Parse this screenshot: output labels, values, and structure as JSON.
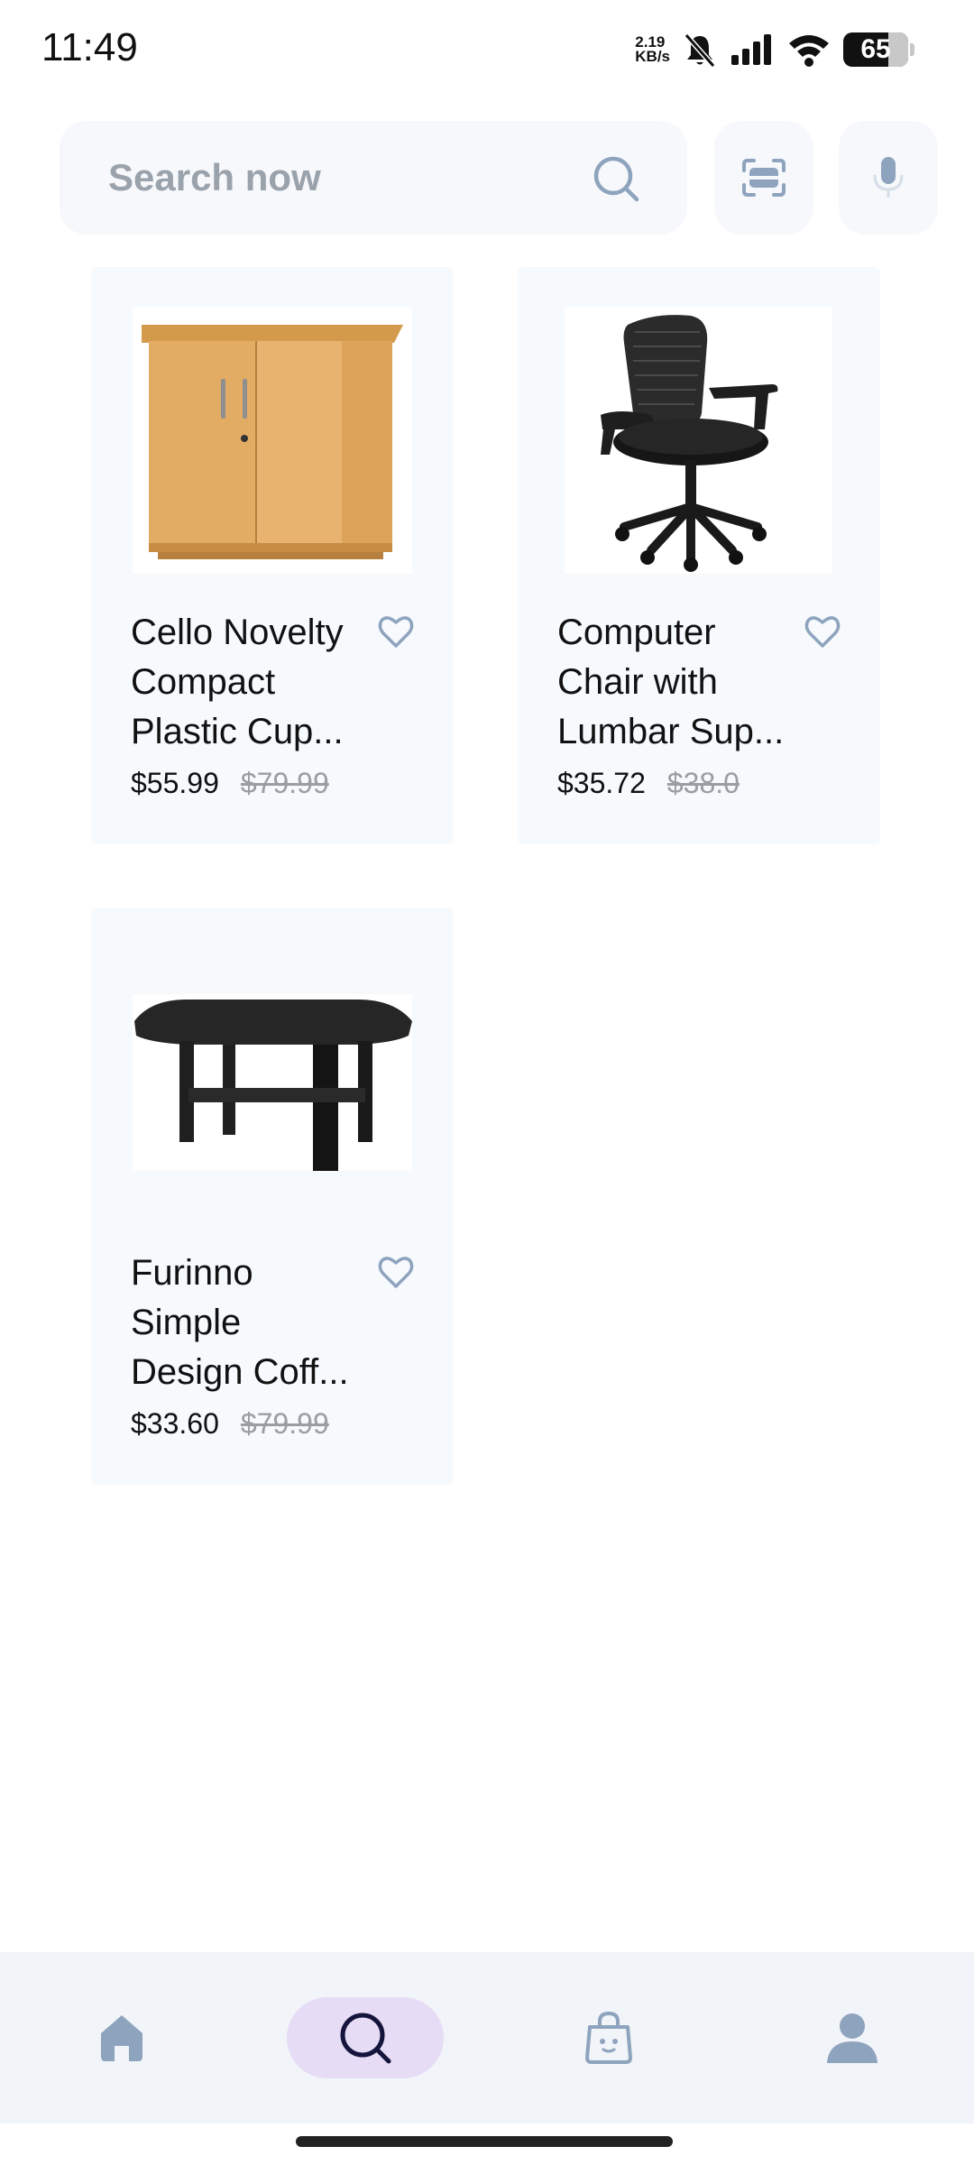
{
  "status_bar": {
    "time": "11:49",
    "net_speed_value": "2.19",
    "net_speed_unit": "KB/s",
    "battery": "65"
  },
  "search": {
    "placeholder": "Search now"
  },
  "products": [
    {
      "title_lines": [
        "Cello Novelty",
        "Compact",
        "Plastic Cup..."
      ],
      "price": "$55.99",
      "old_price": "$79.99"
    },
    {
      "title_lines": [
        "Computer",
        "Chair with",
        "Lumbar Sup..."
      ],
      "price": "$35.72",
      "old_price": "$38.0"
    },
    {
      "title_lines": [
        "Furinno",
        "Simple",
        "Design Coff..."
      ],
      "price": "$33.60",
      "old_price": "$79.99"
    }
  ],
  "bottom_nav": {
    "items": [
      {
        "icon": "home-icon",
        "active": false
      },
      {
        "icon": "search-icon",
        "active": true
      },
      {
        "icon": "bag-icon",
        "active": false
      },
      {
        "icon": "profile-icon",
        "active": false
      }
    ]
  },
  "colors": {
    "accent_pill": "#e7dcf5",
    "nav_icon": "#8ea3bd",
    "active_icon": "#14143c",
    "card_bg": "#f7fafd"
  }
}
